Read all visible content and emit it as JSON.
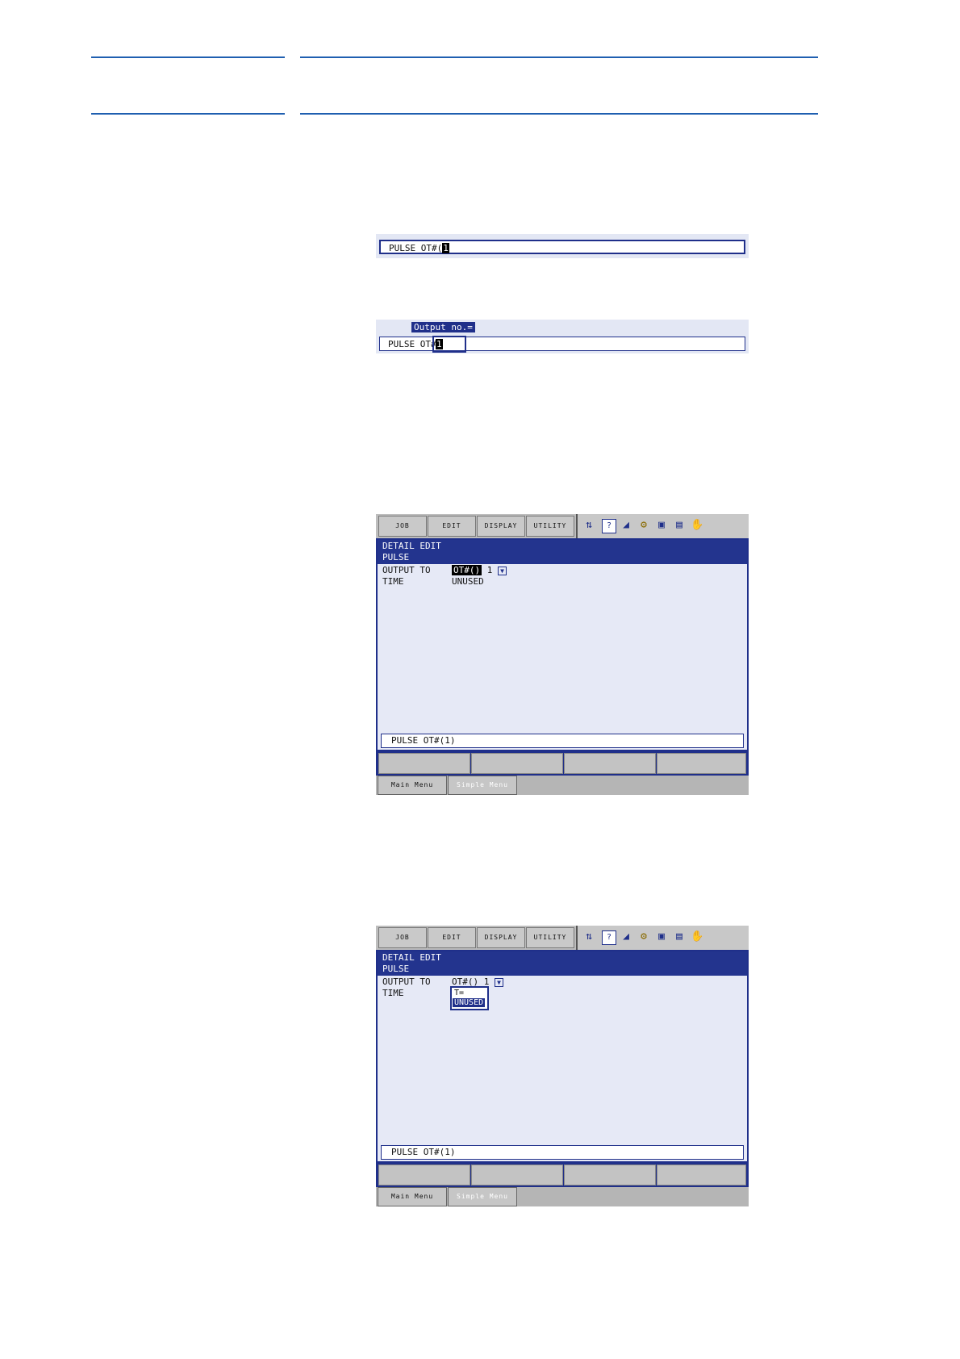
{
  "snippet1": {
    "line_text": "PULSE OT#(",
    "cursor_text": "1"
  },
  "snippet2": {
    "prompt": "Output no.=",
    "line_text": "PULSE OT#",
    "cursor_text": "1"
  },
  "screen1": {
    "menu": [
      "JOB",
      "EDIT",
      "DISPLAY",
      "UTILITY"
    ],
    "title1": "DETAIL EDIT",
    "title2": "PULSE",
    "output_label": "OUTPUT TO",
    "output_value": "OT#()",
    "output_num": "1",
    "time_label": "TIME",
    "time_value": "UNUSED",
    "input_line": "PULSE OT#(1)",
    "main_menu": "Main Menu",
    "simple_menu": "Simple Menu"
  },
  "screen2": {
    "menu": [
      "JOB",
      "EDIT",
      "DISPLAY",
      "UTILITY"
    ],
    "title1": "DETAIL EDIT",
    "title2": "PULSE",
    "output_label": "OUTPUT TO",
    "output_value": "OT#()",
    "output_num": "1",
    "time_label": "TIME",
    "popup_opt1": "T=",
    "popup_opt2": "UNUSED",
    "input_line": "PULSE OT#(1)",
    "main_menu": "Main Menu",
    "simple_menu": "Simple Menu"
  },
  "icons": [
    "mode-switch-icon",
    "help-icon",
    "signal-strength-icon",
    "robot-arm-icon",
    "camera-icon",
    "document-edit-icon",
    "hand-icon"
  ]
}
